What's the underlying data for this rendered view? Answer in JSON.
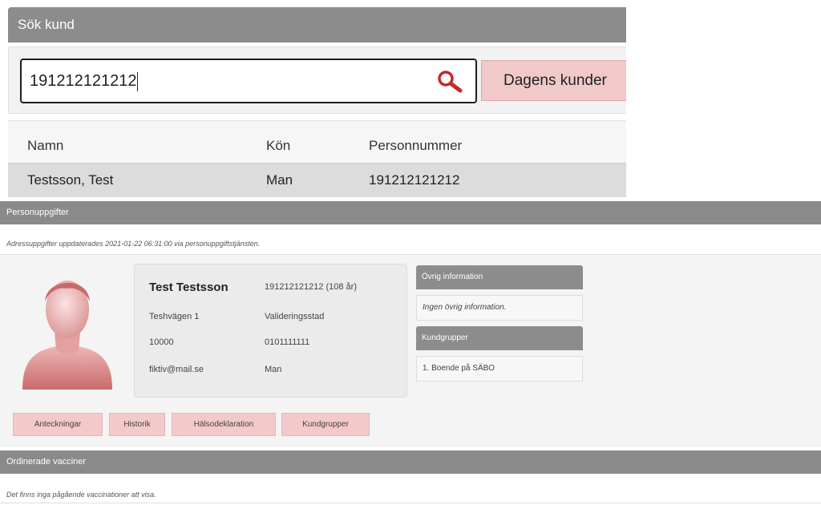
{
  "search": {
    "title": "Sök kund",
    "value": "191212121212",
    "today_button": "Dagens kunder"
  },
  "results": {
    "columns": [
      "Namn",
      "Kön",
      "Personnummer"
    ],
    "rows": [
      [
        "Testsson, Test",
        "Man",
        "191212121212"
      ]
    ]
  },
  "personal": {
    "title": "Personuppgifter",
    "updated_note": "Adressuppgifter uppdaterades 2021-01-22 06:31:00 via personuppgiftstjänsten.",
    "name": "Test Testsson",
    "personnummer": "191212121212 (108 år)",
    "street": "Teshvägen 1",
    "city": "Valideringsstad",
    "postcode": "10000",
    "phone": "0101111111",
    "email": "fiktiv@mail.se",
    "gender": "Man"
  },
  "other_info": {
    "title": "Övrig information",
    "text": "Ingen övrig information."
  },
  "customer_groups": {
    "title": "Kundgrupper",
    "text": "1. Boende på SÄBO"
  },
  "tabs": [
    "Anteckningar",
    "Historik",
    "Hälsodeklaration",
    "Kundgrupper"
  ],
  "vaccines": {
    "title": "Ordinerade vacciner",
    "note": "Det finns inga pågående vaccinationer att visa."
  },
  "colors": {
    "header_gray": "#8c8c8c",
    "button_pink": "#f1c9c9",
    "search_icon_red": "#c62828"
  }
}
